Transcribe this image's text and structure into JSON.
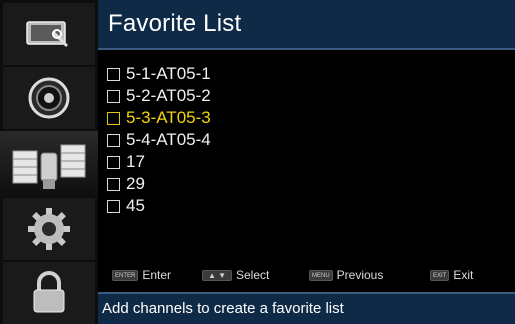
{
  "header": {
    "title": "Favorite List"
  },
  "sidebar": {
    "items": [
      {
        "icon": "picture-icon"
      },
      {
        "icon": "sound-icon"
      },
      {
        "icon": "satellite-icon",
        "active": true
      },
      {
        "icon": "gear-icon"
      },
      {
        "icon": "lock-icon"
      }
    ]
  },
  "channels": [
    {
      "label": "5-1-AT05-1",
      "selected": false
    },
    {
      "label": "5-2-AT05-2",
      "selected": false
    },
    {
      "label": "5-3-AT05-3",
      "selected": true
    },
    {
      "label": "5-4-AT05-4",
      "selected": false
    },
    {
      "label": "17",
      "selected": false
    },
    {
      "label": "29",
      "selected": false
    },
    {
      "label": "45",
      "selected": false
    }
  ],
  "hints": {
    "enter": {
      "key": "ENTER",
      "label": "Enter"
    },
    "select": {
      "key": "▲ ▼",
      "label": "Select"
    },
    "previous": {
      "key": "MENU",
      "label": "Previous"
    },
    "exit": {
      "key": "EXIT",
      "label": "Exit"
    }
  },
  "footer": {
    "message": "Add channels to create a favorite list"
  },
  "colors": {
    "header_bg": "#0f2a47",
    "selected_text": "#f2d50f",
    "normal_text": "#f0f0f0"
  }
}
